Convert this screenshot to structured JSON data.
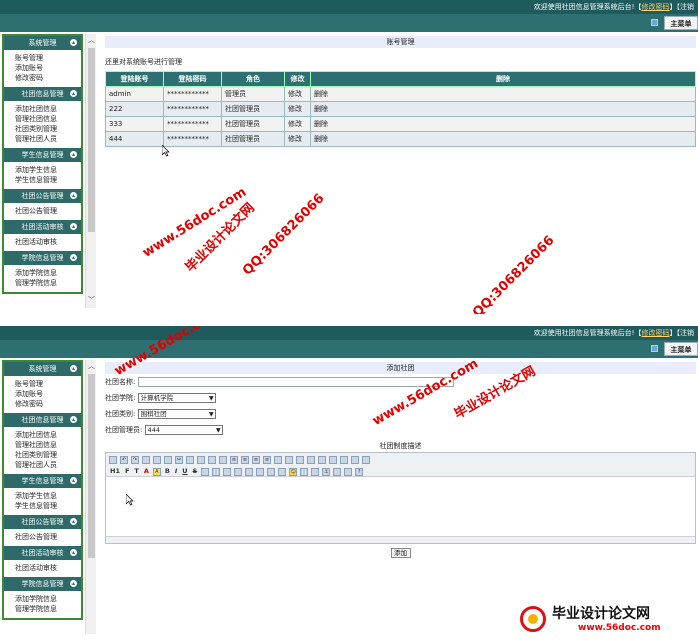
{
  "header": {
    "welcome_text": "欢迎使用社团信息管理系统后台!【",
    "welcome_link": "修改密码",
    "welcome_end": "】",
    "welcome_text2": "欢迎使用社团信息管理系统后台!【",
    "welcome_link2": "修改密码",
    "welcome_end2": "】【注销",
    "logout_link": "注销",
    "main_menu_label": "主菜单"
  },
  "sidebar": {
    "groups": [
      {
        "title": "系统管理",
        "items": [
          "账号管理",
          "添加账号",
          "修改密码"
        ]
      },
      {
        "title": "社团信息管理",
        "items": [
          "添加社团信息",
          "管理社团信息",
          "社团类别管理",
          "管理社团人员"
        ]
      },
      {
        "title": "学生信息管理",
        "items": [
          "添加学生信息",
          "学生信息管理"
        ]
      },
      {
        "title": "社团公告管理",
        "items": [
          "社团公告管理"
        ]
      },
      {
        "title": "社团活动审核",
        "items": [
          "社团活动审核"
        ]
      },
      {
        "title": "学院信息管理",
        "items": [
          "添加学院信息",
          "管理学院信息"
        ]
      }
    ]
  },
  "account_page": {
    "title": "账号管理",
    "description": "还里对系统账号进行管理",
    "columns": [
      "登陆账号",
      "登陆密码",
      "角色",
      "修改",
      "删除"
    ],
    "rows": [
      [
        "admin",
        "************",
        "管理员",
        "修改",
        "删除"
      ],
      [
        "222",
        "************",
        "社团管理员",
        "修改",
        "删除"
      ],
      [
        "333",
        "************",
        "社团管理员",
        "修改",
        "删除"
      ],
      [
        "444",
        "************",
        "社团管理员",
        "修改",
        "删除"
      ]
    ]
  },
  "add_page": {
    "title": "添加社团",
    "name_label": "社团名称:",
    "name_value": "",
    "college_label": "社团学院:",
    "college_value": "计算机学院",
    "category_label": "社团类别:",
    "category_value": "围棋社团",
    "manager_label": "社团管理员:",
    "manager_value": "444",
    "editor_title": "社团制度描述",
    "submit_label": "添加"
  },
  "watermarks": {
    "site1": "www.56doc.com",
    "qq": "QQ:306826066",
    "brand": "毕业设计论文网"
  },
  "logo": {
    "name": "毕业设计论文网",
    "url": "www.56doc.com"
  },
  "colors": {
    "header_dark": "#1f5a5c",
    "table_header": "#2e6f72",
    "sidebar_border": "#3c8a2e",
    "watermark_red": "#e00000"
  }
}
